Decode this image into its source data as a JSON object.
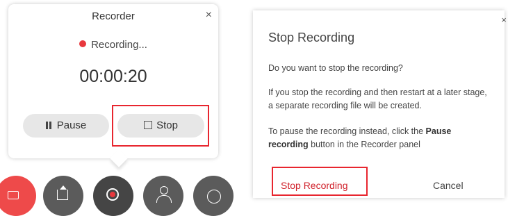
{
  "recorder": {
    "title": "Recorder",
    "close_glyph": "×",
    "status": "Recording...",
    "timer": "00:00:20",
    "pause_label": "Pause",
    "stop_label": "Stop"
  },
  "toolbar": {
    "buttons": [
      {
        "icon": "video-off-icon"
      },
      {
        "icon": "share-icon"
      },
      {
        "icon": "record-icon"
      },
      {
        "icon": "participants-icon"
      },
      {
        "icon": "chat-icon"
      }
    ]
  },
  "dialog": {
    "title": "Stop Recording",
    "close_glyph": "×",
    "question": "Do you want to stop the recording?",
    "info": "If you stop the recording and then restart at a later stage, a separate recording file will be created.",
    "pause_hint_prefix": "To pause the recording instead, click the ",
    "pause_hint_bold": "Pause recording",
    "pause_hint_suffix": " button in the Recorder panel",
    "stop_button": "Stop Recording",
    "cancel_button": "Cancel"
  },
  "colors": {
    "recording_dot": "#e8383d",
    "highlight": "#e8262f",
    "stop_text": "#d0202a",
    "button_bg": "#e7e7e7",
    "toolbar_bg": "#5b5b5b",
    "video_button_bg": "#ee4a4a"
  }
}
